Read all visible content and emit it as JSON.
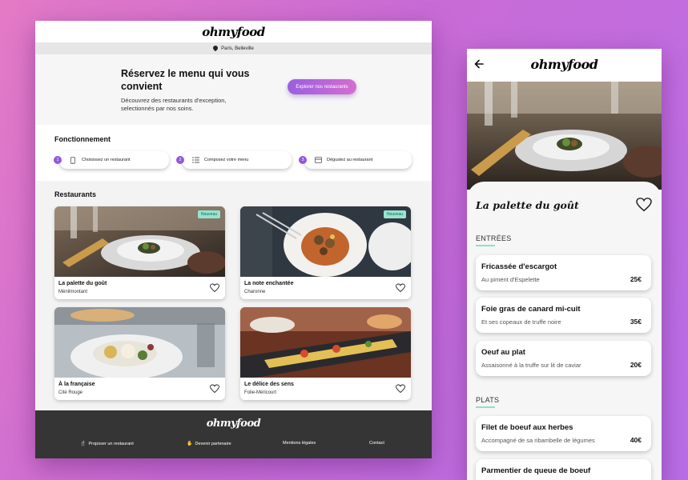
{
  "brand": "ohmyfood",
  "desktop": {
    "location": "Paris, Belleville",
    "hero": {
      "title": "Réservez le menu qui vous convient",
      "subtitle": "Découvrez des restaurants d'exception, selectionnés par nos soins.",
      "button": "Explorer nos restaurants"
    },
    "how": {
      "title": "Fonctionnement",
      "steps": [
        {
          "num": "1",
          "label": "Choisissez un restaurant",
          "icon": "phone-icon"
        },
        {
          "num": "2",
          "label": "Composez votre menu",
          "icon": "list-icon"
        },
        {
          "num": "3",
          "label": "Dégustez au restaurant",
          "icon": "tray-icon"
        }
      ]
    },
    "restaurants": {
      "title": "Restaurants",
      "items": [
        {
          "name": "La palette du goût",
          "area": "Ménilmontant",
          "badge": "Nouveau"
        },
        {
          "name": "La note enchantée",
          "area": "Charonne",
          "badge": "Nouveau"
        },
        {
          "name": "À la française",
          "area": "Cité Rouge",
          "badge": ""
        },
        {
          "name": "Le délice des sens",
          "area": "Folie-Méricourt",
          "badge": ""
        }
      ]
    },
    "footer": {
      "links": [
        "Proposer un restaurant",
        "Devenir partenaire",
        "Mentions légales",
        "Contact"
      ]
    }
  },
  "mobile": {
    "restaurant_name": "La palette du goût",
    "categories": [
      {
        "title": "ENTRÉES",
        "dishes": [
          {
            "name": "Fricassée d'escargot",
            "desc": "Au piment d'Espelette",
            "price": "25€"
          },
          {
            "name": "Foie gras de canard mi-cuit",
            "desc": "Et ses copeaux de truffe noire",
            "price": "35€"
          },
          {
            "name": "Oeuf au plat",
            "desc": "Assaisonné à la truffe sur lit de caviar",
            "price": "20€"
          }
        ]
      },
      {
        "title": "PLATS",
        "dishes": [
          {
            "name": "Filet de boeuf aux herbes",
            "desc": "Accompagné de sa ribambelle de légumes",
            "price": "40€"
          },
          {
            "name": "Parmentier de queue de boeuf",
            "desc": "",
            "price": ""
          }
        ]
      }
    ]
  },
  "colors": {
    "accent_purple": "#9356dc",
    "accent_pink": "#d46ed0",
    "badge_green": "#99e2d0",
    "footer_dark": "#353535"
  }
}
